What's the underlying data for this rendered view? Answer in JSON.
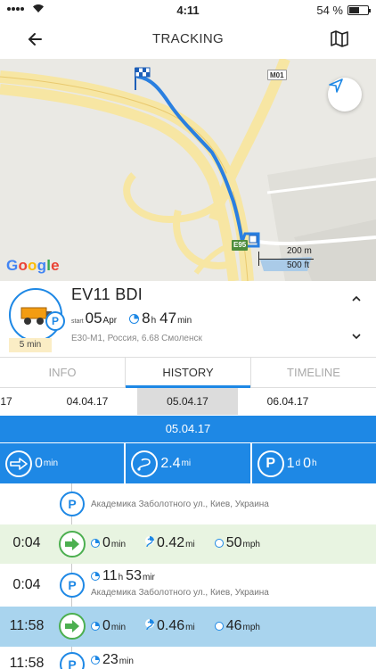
{
  "status_bar": {
    "time": "4:11",
    "battery": "54 %",
    "battery_level": 0.54
  },
  "header": {
    "title": "TRACKING"
  },
  "map": {
    "google_label": "Google",
    "scale_top": "200 m",
    "scale_bottom": "500 ft",
    "road_labels": [
      "M01",
      "E95"
    ]
  },
  "vehicle": {
    "name": "EV11 BDI",
    "badge": "5 min",
    "start_label": "start",
    "start_day": "05",
    "start_month": "Apr",
    "duration_hours": "8",
    "duration_h_unit": "h",
    "duration_minutes": "47",
    "duration_min_unit": "min",
    "address": "E30-M1, Россия, 6.68  Смоленск"
  },
  "tabs": [
    {
      "label": "INFO"
    },
    {
      "label": "HISTORY"
    },
    {
      "label": "TIMELINE"
    }
  ],
  "dates": [
    "17",
    "04.04.17",
    "05.04.17",
    "06.04.17"
  ],
  "selected_date": "05.04.17",
  "summary": {
    "drive_value": "0",
    "drive_unit": "min",
    "distance_value": "2.4",
    "distance_unit": "mi",
    "park_days": "1",
    "park_days_unit": "d",
    "park_hours": "0",
    "park_hours_unit": "h"
  },
  "timeline": [
    {
      "type": "park",
      "time": "",
      "address": "Академика Заболотного ул., Киев, Украина"
    },
    {
      "type": "drive",
      "time": "0:04",
      "duration": "0",
      "duration_unit": "min",
      "distance": "0.42",
      "distance_unit": "mi",
      "speed": "50",
      "speed_unit": "mph"
    },
    {
      "type": "park",
      "time": "0:04",
      "hours": "11",
      "hours_unit": "h",
      "minutes": "53",
      "minutes_unit": "mir",
      "address": "Академика Заболотного ул., Киев, Украина"
    },
    {
      "type": "drive",
      "time": "11:58",
      "duration": "0",
      "duration_unit": "min",
      "distance": "0.46",
      "distance_unit": "mi",
      "speed": "46",
      "speed_unit": "mph"
    },
    {
      "type": "park",
      "time": "11:58",
      "minutes": "23",
      "minutes_unit": "min"
    }
  ],
  "colors": {
    "accent": "#1e88e5",
    "drive_green": "#4caf50",
    "row_green": "#e8f4e1",
    "row_blue": "#a9d4ee",
    "badge": "#fbedc5"
  }
}
